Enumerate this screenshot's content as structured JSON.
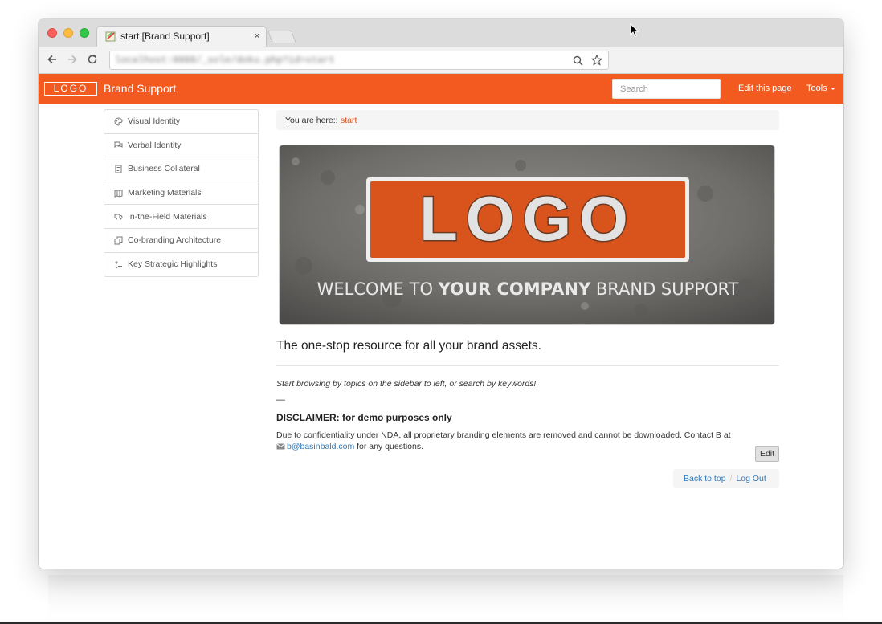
{
  "browser": {
    "tab_title": "start [Brand Support]",
    "tab_close": "×",
    "url": "localhost:8888/_sole/doku.php?id=start"
  },
  "header": {
    "logo_text": "LOGO",
    "title": "Brand Support",
    "search_placeholder": "Search",
    "edit_page": "Edit this page",
    "tools": "Tools",
    "accent_color": "#f35a1f"
  },
  "sidebar": {
    "items": [
      {
        "label": "Visual Identity",
        "icon": "palette-icon"
      },
      {
        "label": "Verbal Identity",
        "icon": "speech-bubble-icon"
      },
      {
        "label": "Business Collateral",
        "icon": "document-icon"
      },
      {
        "label": "Marketing Materials",
        "icon": "map-icon"
      },
      {
        "label": "In-the-Field Materials",
        "icon": "truck-icon"
      },
      {
        "label": "Co-branding Architecture",
        "icon": "copy-icon"
      },
      {
        "label": "Key Strategic Highlights",
        "icon": "sparkle-icon"
      }
    ]
  },
  "breadcrumb": {
    "label": "You are here::",
    "current": "start"
  },
  "hero": {
    "logo_text": "LOGO",
    "welcome_pre": "WELCOME TO ",
    "welcome_bold": "YOUR COMPANY",
    "welcome_post": " BRAND SUPPORT"
  },
  "content": {
    "tagline": "The one-stop resource for all your brand assets.",
    "browse_text": "Start browsing by topics on the sidebar to left, or search by keywords!",
    "dash": "—",
    "disclaimer_title": "DISCLAIMER: for demo purposes only",
    "disclaimer_body": "Due to confidentiality under NDA, all proprietary branding elements are removed and cannot be downloaded. Contact B at",
    "email": "b@basinbald.com",
    "disclaimer_tail": " for any questions.",
    "edit_button": "Edit"
  },
  "footer": {
    "back_to_top": "Back to top",
    "separator": "/",
    "log_out": "Log Out"
  }
}
